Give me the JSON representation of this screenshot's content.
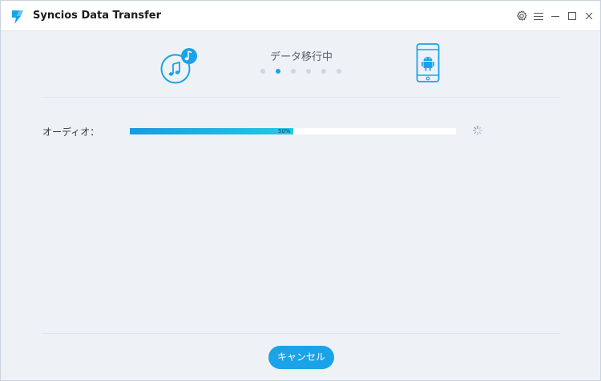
{
  "app": {
    "title": "Syncios Data Transfer",
    "brand_color": "#1aa3e8"
  },
  "window_controls": {
    "settings_icon": "gear-icon",
    "menu_icon": "hamburger-icon",
    "minimize_icon": "minimize-icon",
    "maximize_icon": "maximize-icon",
    "close_icon": "close-icon"
  },
  "transfer": {
    "status": "データ移行中",
    "source_icon": "music-note-icon",
    "target_icon": "android-phone-icon",
    "step_count": 6,
    "active_step": 2
  },
  "items": [
    {
      "label": "オーディオ：",
      "progress_percent": 50,
      "progress_text": "50%",
      "state_icon": "loading-spinner-icon"
    }
  ],
  "actions": {
    "cancel_label": "キャンセル"
  }
}
